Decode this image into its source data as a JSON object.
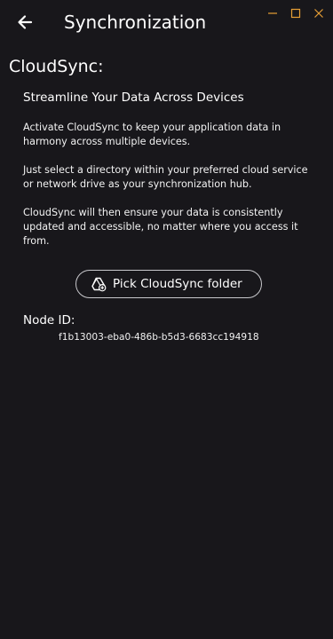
{
  "header": {
    "title": "Synchronization",
    "back_icon": "arrow-left-icon"
  },
  "window_controls": {
    "minimize_icon": "minimize-icon",
    "maximize_icon": "maximize-icon",
    "close_icon": "close-icon",
    "accent_color": "#e8a035"
  },
  "section": {
    "title": "CloudSync:",
    "subtitle": "Streamline Your Data Across Devices",
    "paragraphs": [
      "Activate CloudSync to keep your application data in harmony across multiple devices.",
      "Just select a directory within your preferred cloud service or network drive as your synchronization hub.",
      "CloudSync will then ensure your data is consistently updated and accessible, no matter where you access it from."
    ]
  },
  "pick_button": {
    "label": "Pick CloudSync folder",
    "icon": "google-drive-add-icon"
  },
  "node": {
    "label": "Node ID:",
    "value": "f1b13003-eba0-486b-b5d3-6683cc194918"
  },
  "colors": {
    "background": "#18171b",
    "text": "#ffffff",
    "button_border": "#c8c8cc"
  }
}
